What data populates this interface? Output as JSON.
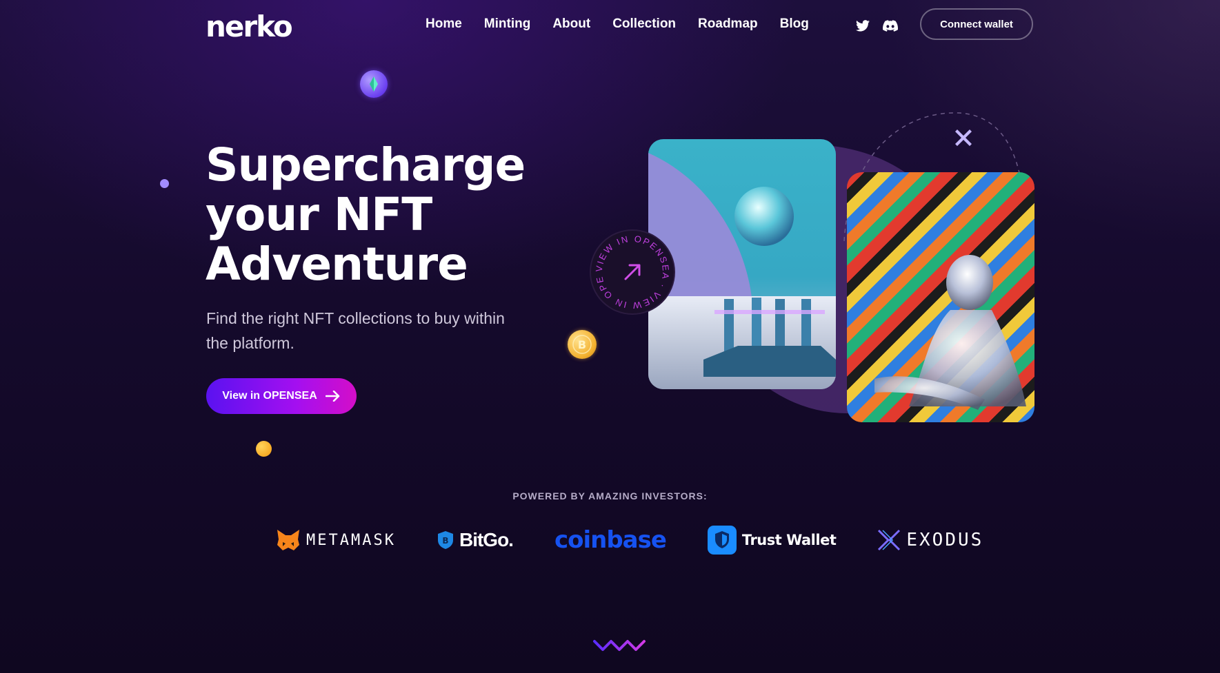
{
  "brand": {
    "name": "nerko"
  },
  "nav": {
    "items": [
      {
        "label": "Home"
      },
      {
        "label": "Minting"
      },
      {
        "label": "About"
      },
      {
        "label": "Collection"
      },
      {
        "label": "Roadmap"
      },
      {
        "label": "Blog"
      }
    ],
    "social": [
      "twitter-icon",
      "discord-icon"
    ],
    "connect_label": "Connect wallet"
  },
  "hero": {
    "title_lines": [
      "Supercharge",
      "your NFT",
      "Adventure"
    ],
    "subtitle": "Find the right NFT collections to buy within the platform.",
    "cta_label": "View in OPENSEA",
    "badge_text": "VIEW IN OPENSEA · VIEW IN OPENSEA ·"
  },
  "investors": {
    "label": "POWERED BY AMAZING INVESTORS:",
    "logos": [
      {
        "name": "METAMASK",
        "icon": "metamask-fox-icon",
        "color": "#f6851b"
      },
      {
        "name": "BitGo.",
        "icon": "bitgo-shield-icon",
        "color": "#1e88e5"
      },
      {
        "name": "coinbase",
        "icon": "",
        "color": "#1652f0"
      },
      {
        "name": "Trust Wallet",
        "icon": "trust-shield-icon",
        "color": "#0500ff"
      },
      {
        "name": "EXODUS",
        "icon": "exodus-x-icon",
        "color": "#7b6cff"
      }
    ]
  },
  "colors": {
    "accent": "#a40ff0",
    "accent_start": "#5a12f0",
    "background": "#150a2c"
  }
}
